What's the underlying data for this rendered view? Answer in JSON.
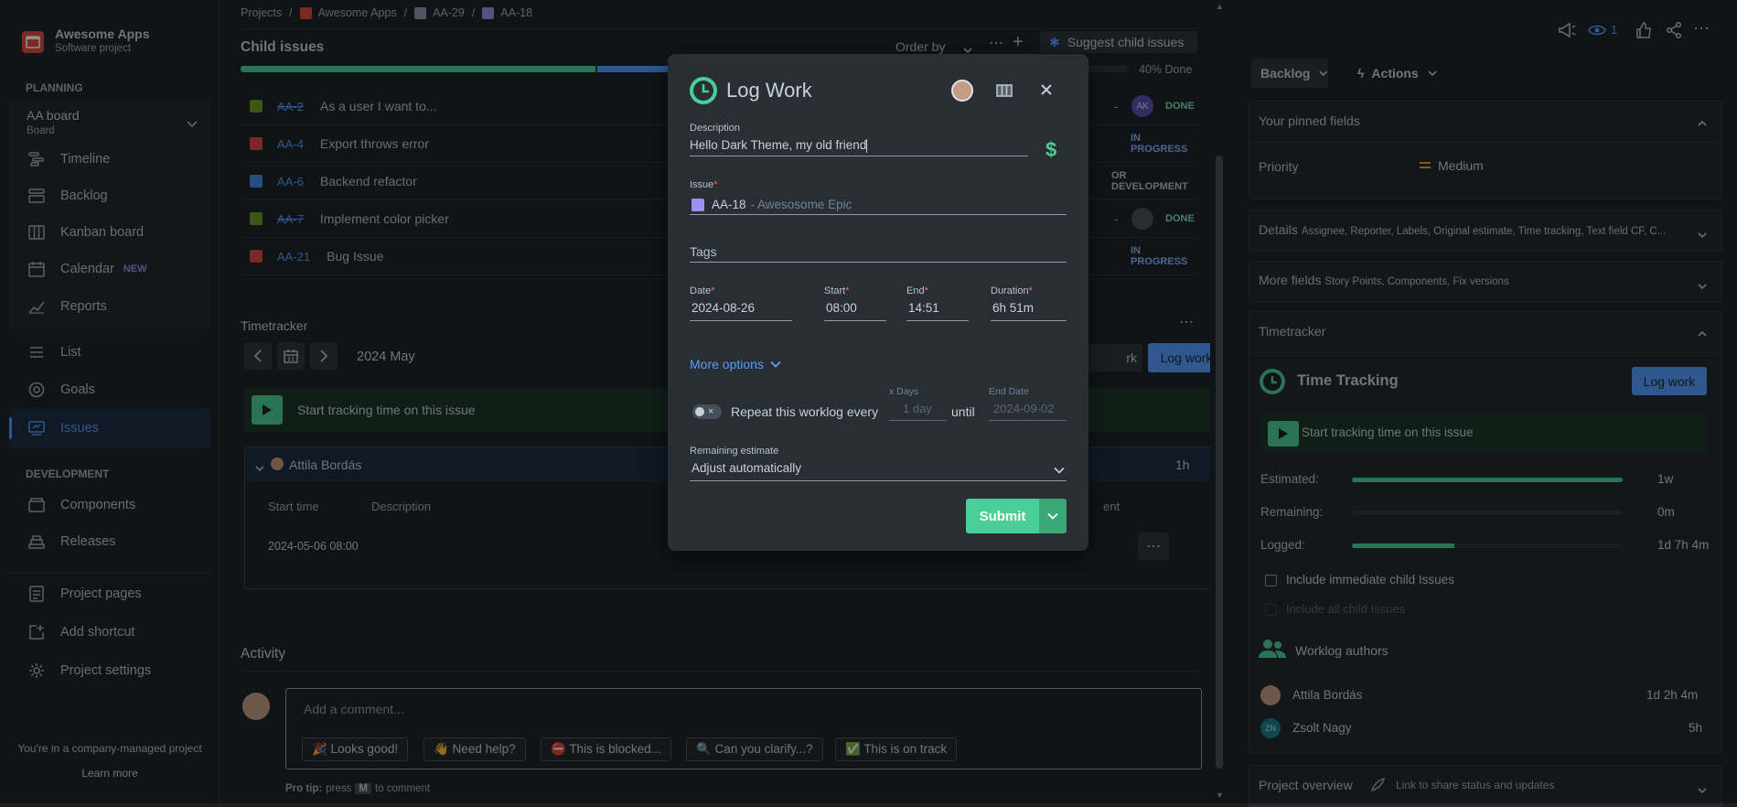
{
  "sidebar": {
    "project_name": "Awesome Apps",
    "project_type": "Software project",
    "planning_header": "PLANNING",
    "board_name": "AA board",
    "board_sub": "Board",
    "items": [
      {
        "label": "Timeline",
        "icon": "timeline-icon"
      },
      {
        "label": "Backlog",
        "icon": "backlog-icon"
      },
      {
        "label": "Kanban board",
        "icon": "kanban-icon"
      },
      {
        "label": "Calendar",
        "icon": "calendar-icon",
        "badge": "NEW"
      },
      {
        "label": "Reports",
        "icon": "reports-icon"
      },
      {
        "label": "List",
        "icon": "list-icon"
      },
      {
        "label": "Goals",
        "icon": "goals-icon"
      },
      {
        "label": "Issues",
        "icon": "issues-icon"
      }
    ],
    "development_header": "DEVELOPMENT",
    "dev_items": [
      {
        "label": "Components"
      },
      {
        "label": "Releases"
      }
    ],
    "bottom_items": [
      {
        "label": "Project pages"
      },
      {
        "label": "Add shortcut"
      },
      {
        "label": "Project settings"
      }
    ],
    "footer_text": "You're in a company-managed project",
    "learn_more": "Learn more"
  },
  "breadcrumb": {
    "projects": "Projects",
    "sep": "/",
    "project": "Awesome Apps",
    "parent": "AA-29",
    "current": "AA-18"
  },
  "child_issues": {
    "title": "Child issues",
    "order_by": "Order by",
    "suggest": "Suggest child issues",
    "progress_text": "40% Done",
    "done_fraction": 0.4,
    "rows": [
      {
        "key": "AA-2",
        "summary": "As a user I want to...",
        "status": "DONE",
        "assignee": "AK",
        "dash": "-",
        "done": true
      },
      {
        "key": "AA-4",
        "summary": "Export throws error",
        "status": "IN PROGRESS",
        "done": false
      },
      {
        "key": "AA-6",
        "summary": "Backend refactor",
        "status": "OR DEVELOPMENT",
        "done": false
      },
      {
        "key": "AA-7",
        "summary": "Implement color picker",
        "status": "DONE",
        "dash": "-",
        "done": true
      },
      {
        "key": "AA-21",
        "summary": "Bug Issue",
        "status": "IN PROGRESS",
        "done": false
      }
    ]
  },
  "timetracker": {
    "title": "Timetracker",
    "month": "2024 May",
    "log_work_partial": "rk",
    "log_work": "Log work",
    "start_tracking": "Start tracking time on this issue",
    "group_author": "Attila Bordás",
    "group_total": "1h",
    "col_start": "Start time",
    "col_desc": "Description",
    "col_partial": "ent",
    "entry_start": "2024-05-06 08:00"
  },
  "activity": {
    "title": "Activity",
    "comment_placeholder": "Add a comment...",
    "chips": [
      "🎉 Looks good!",
      "👋 Need help?",
      "⛔ This is blocked...",
      "🔍 Can you clarify...?",
      "✅ This is on track"
    ],
    "pro_tip": "Pro tip:",
    "press": "press",
    "key": "M",
    "to_comment": "to comment"
  },
  "right": {
    "watchers": "1",
    "backlog": "Backlog",
    "actions": "Actions",
    "pinned": "Your pinned fields",
    "priority_label": "Priority",
    "priority_value": "Medium",
    "details": "Details",
    "details_sub": "Assignee, Reporter, Labels, Original estimate, Time tracking, Text field CF, C...",
    "more_fields": "More fields",
    "more_fields_sub": "Story Points, Components, Fix versions",
    "timetracker": "Timetracker",
    "time_tracking": "Time Tracking",
    "log_work": "Log work",
    "start_tracking": "Start tracking time on this issue",
    "estimated_label": "Estimated:",
    "estimated": "1w",
    "estimated_fraction": 1.0,
    "remaining_label": "Remaining:",
    "remaining": "0m",
    "remaining_fraction": 0.0,
    "logged_label": "Logged:",
    "logged": "1d 7h 4m",
    "logged_fraction": 0.38,
    "include_child": "Include immediate child Issues",
    "include_all": "Include all child Issues",
    "worklog_authors": "Worklog authors",
    "authors": [
      {
        "name": "Attila Bordás",
        "time": "1d 2h 4m"
      },
      {
        "name": "Zsolt Nagy",
        "initials": "ZN",
        "time": "5h"
      }
    ],
    "project_overview": "Project overview",
    "share_status": "Link to share status and updates"
  },
  "modal": {
    "title": "Log Work",
    "description_label": "Description",
    "description_value": "Hello Dark Theme, my old friend",
    "issue_label": "Issue",
    "issue_key": "AA-18",
    "issue_name": "- Awesosome Epic",
    "tags_label": "Tags",
    "date_label": "Date",
    "date_value": "2024-08-26",
    "start_label": "Start",
    "start_value": "08:00",
    "end_label": "End",
    "end_value": "14:51",
    "duration_label": "Duration",
    "duration_value": "6h 51m",
    "more_options": "More options",
    "repeat_text": "Repeat this worklog every",
    "xdays_label": "x Days",
    "xdays_placeholder": "1 day",
    "until": "until",
    "enddate_label": "End Date",
    "enddate_placeholder": "2024-09-02",
    "remaining_label": "Remaining estimate",
    "remaining_value": "Adjust automatically",
    "submit": "Submit",
    "req": "*"
  },
  "colors": {
    "accent": "#579dff",
    "green": "#4bce97",
    "done_green": "#7ee2b8",
    "page_bg": "#1d2125",
    "modal_bg": "#282e33"
  }
}
